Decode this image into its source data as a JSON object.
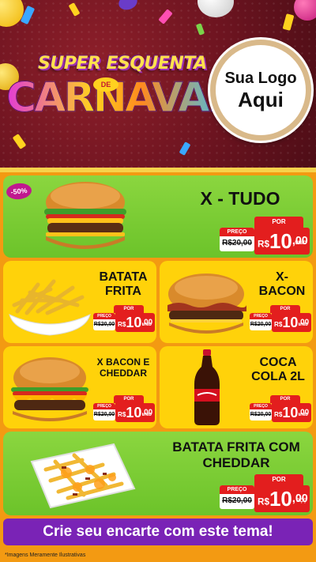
{
  "header": {
    "title_top": "SUPER ESQUENTA",
    "title_de": "DE",
    "title_main": "CARNAVAL",
    "logo_line1": "Sua Logo",
    "logo_line2": "Aqui"
  },
  "discount_badge": "-50%",
  "products": [
    {
      "name": "X - TUDO",
      "por": "POR",
      "preco_label": "PREÇO",
      "old_price": "R$20,00",
      "currency": "R$",
      "price_int": "10",
      "price_cents": ",00",
      "unit": "UNID"
    },
    {
      "name": "BATATA FRITA",
      "por": "POR",
      "preco_label": "PREÇO",
      "old_price": "R$20,00",
      "currency": "R$",
      "price_int": "10",
      "price_cents": ",00",
      "unit": "UNID"
    },
    {
      "name": "X-BACON",
      "por": "POR",
      "preco_label": "PREÇO",
      "old_price": "R$20,00",
      "currency": "R$",
      "price_int": "10",
      "price_cents": ",00",
      "unit": "UNID"
    },
    {
      "name": "X BACON E CHEDDAR",
      "por": "POR",
      "preco_label": "PREÇO",
      "old_price": "R$20,00",
      "currency": "R$",
      "price_int": "10",
      "price_cents": ",00",
      "unit": "UNID"
    },
    {
      "name": "COCA COLA 2L",
      "por": "POR",
      "preco_label": "PREÇO",
      "old_price": "R$20,00",
      "currency": "R$",
      "price_int": "10",
      "price_cents": ",00",
      "unit": "UNID"
    },
    {
      "name": "BATATA FRITA COM CHEDDAR",
      "por": "POR",
      "preco_label": "PREÇO",
      "old_price": "R$20,00",
      "currency": "R$",
      "price_int": "10",
      "price_cents": ",00",
      "unit": "PÇÇ"
    }
  ],
  "cta": "Crie seu encarte com este tema!",
  "footnote": "*Imagens Meramente Ilustrativas",
  "colors": {
    "background": "#f39a12",
    "green_card": "#7ccd33",
    "yellow_card": "#ffd20a",
    "price_red": "#e31e1e",
    "cta_purple": "#7a23b6",
    "header_red": "#7a1825"
  },
  "icons": [
    "burger-icon",
    "fries-icon",
    "bacon-burger-icon",
    "cheddar-burger-icon",
    "cola-bottle-icon",
    "cheddar-fries-icon"
  ]
}
